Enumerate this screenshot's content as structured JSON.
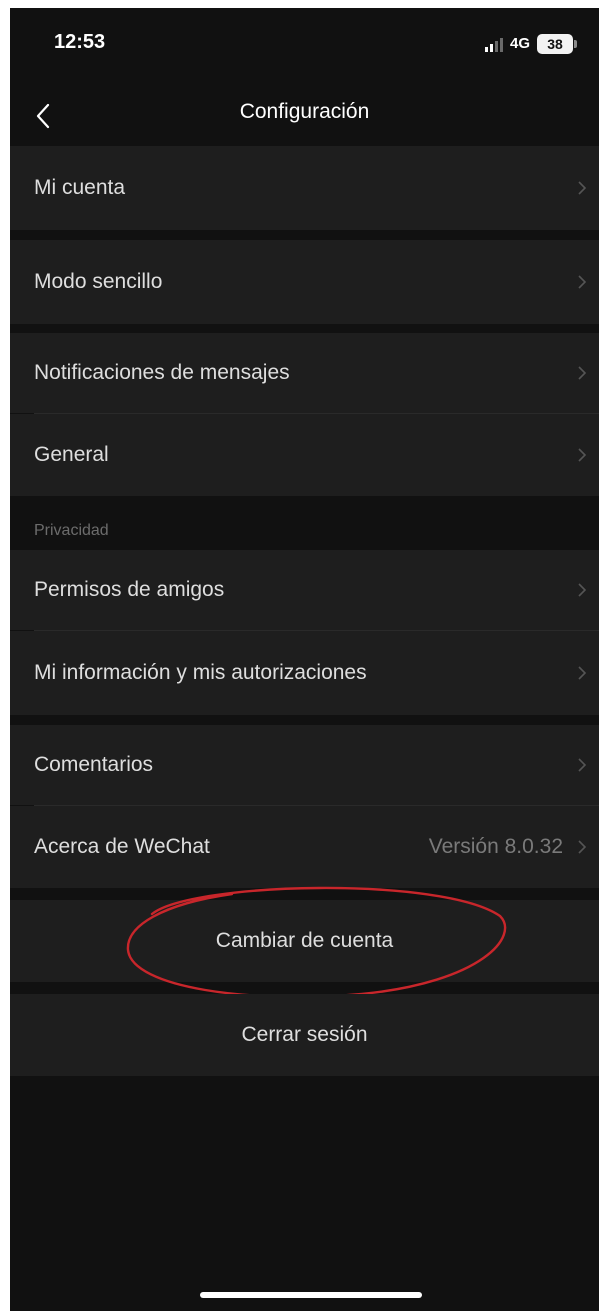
{
  "status_bar": {
    "time": "12:53",
    "network": "4G",
    "battery": "38"
  },
  "nav": {
    "title": "Configuración",
    "back_icon": "chevron-left-icon"
  },
  "sections": {
    "account": {
      "label": "Mi cuenta"
    },
    "simple_mode": {
      "label": "Modo sencillo"
    },
    "notifications": {
      "label": "Notificaciones de mensajes"
    },
    "general": {
      "label": "General"
    },
    "privacy_header": "Privacidad",
    "friend_permissions": {
      "label": "Permisos de amigos"
    },
    "my_info": {
      "label": "Mi información y mis autorizaciones"
    },
    "feedback": {
      "label": "Comentarios"
    },
    "about": {
      "label": "Acerca de WeChat",
      "value": "Versión 8.0.32"
    }
  },
  "actions": {
    "switch_account": "Cambiar de cuenta",
    "logout": "Cerrar sesión"
  },
  "colors": {
    "background": "#111111",
    "row": "#1e1e1e",
    "text": "#dedede",
    "secondary_text": "#7a7a7a",
    "annotation": "#c8262b"
  }
}
